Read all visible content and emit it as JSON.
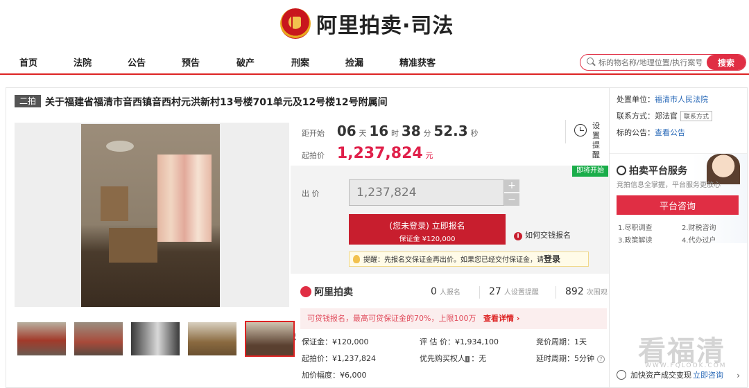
{
  "header": {
    "brand": "阿里拍卖·司法"
  },
  "nav": {
    "items": [
      "首页",
      "法院",
      "公告",
      "预告",
      "破产",
      "刑案",
      "捡漏",
      "精准获客"
    ]
  },
  "search": {
    "placeholder": "标的物名称/地理位置/执行案号",
    "button": "搜索"
  },
  "item": {
    "round_badge": "二拍",
    "title": "关于福建省福清市音西镇音西村元洪新村13号楼701单元及12号楼12号附属间"
  },
  "countdown": {
    "label": "距开始",
    "days": "06",
    "days_unit": "天",
    "hours": "16",
    "hours_unit": "时",
    "minutes": "38",
    "minutes_unit": "分",
    "seconds": "52.3",
    "seconds_unit": "秒"
  },
  "remind": {
    "line1": "设置",
    "line2": "提醒"
  },
  "start_price": {
    "label": "起拍价",
    "value": "1,237,824",
    "unit": "元"
  },
  "bid": {
    "badge": "即将开始",
    "label": "出 价",
    "value": "1,237,824",
    "plus": "+",
    "minus": "−",
    "signup_line1": "(您未登录) 立即报名",
    "signup_line2": "保证金 ¥120,000",
    "howto": "如何交钱报名",
    "tip_text": "提醒：先报名交保证金再出价。如果您已经交付保证金，请",
    "tip_login": "登录"
  },
  "stats": {
    "brand": "阿里拍卖",
    "signups": "0",
    "signups_label": "人报名",
    "reminders": "27",
    "reminders_label": "人设置提醒",
    "views": "892",
    "views_label": "次围观"
  },
  "loan": {
    "text": "可贷钱报名，最高可贷保证金的70%，上限100万",
    "link": "查看详情 ›"
  },
  "details": {
    "deposit": "保证金：¥120,000",
    "appraisal": "评 估 价：¥1,934,100",
    "cycle": "竞价周期：1天",
    "start": "起拍价：¥1,237,824",
    "priority_label": "优先购买权人",
    "priority_icon": "i",
    "priority_value": "：无",
    "delay": "延时周期：5分钟",
    "increment": "加价幅度：¥6,000"
  },
  "sidebar": {
    "unit_label": "处置单位：",
    "unit_value": "福清市人民法院",
    "contact_label": "联系方式：郑法官",
    "contact_btn": "联系方式",
    "notice_label": "标的公告：",
    "notice_link": "查看公告",
    "service_title": "拍卖平台服务",
    "service_sub": "竞拍信息全掌握，平台服务更放心",
    "consult": "平台咨询",
    "services": [
      "1.尽职调查",
      "2.财税咨询",
      "3.政策解读",
      "4.代办过户"
    ],
    "footer_text": "加快资产成交变现",
    "footer_link": "立即咨询"
  },
  "watermark": {
    "main": "看福清",
    "sub": "WWW.FQLOOK.COM"
  },
  "colors": {
    "accent": "#e02e44",
    "dark_red": "#c81e2e",
    "green": "#1aad4a",
    "link": "#2a6ab8"
  }
}
